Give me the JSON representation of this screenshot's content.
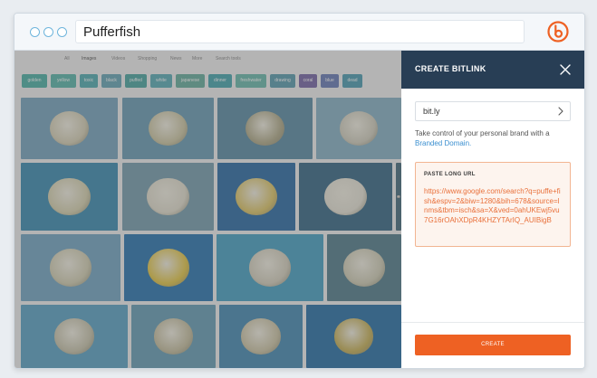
{
  "browser": {
    "url_text": "Pufferfish"
  },
  "search_page": {
    "tabs": [
      "All",
      "Images",
      "Videos",
      "Shopping",
      "News",
      "More",
      "Search tools"
    ],
    "chips": [
      {
        "label": "golden",
        "color": "#4fb3a8"
      },
      {
        "label": "yellow",
        "color": "#5cb8ad"
      },
      {
        "label": "toxic",
        "color": "#54aeb4"
      },
      {
        "label": "black",
        "color": "#6aa9b8"
      },
      {
        "label": "puffed",
        "color": "#4ea8a4"
      },
      {
        "label": "white",
        "color": "#5daeb9"
      },
      {
        "label": "japanese",
        "color": "#6ab0a0"
      },
      {
        "label": "dinner",
        "color": "#4aa8b0"
      },
      {
        "label": "freshwater",
        "color": "#6dbcae"
      },
      {
        "label": "drawing",
        "color": "#5d9fb1"
      },
      {
        "label": "coral",
        "color": "#7a6aa8"
      },
      {
        "label": "blue",
        "color": "#6b7fb8"
      },
      {
        "label": "dead",
        "color": "#4f9fb3"
      }
    ]
  },
  "panel": {
    "title": "CREATE BITLINK",
    "domain_value": "bit.ly",
    "info_text": "Take control of your personal brand with a",
    "info_link": "Branded Domain.",
    "paste_label": "PASTE LONG URL",
    "long_url": "https://www.google.com/search?q=puffe+fish&espv=2&biw=1280&bih=678&source=lnms&tbm=isch&sa=X&ved=0ahUKEwj5vu7G16rOAhXDpR4KHZYTArIQ_AUIBigB",
    "create_label": "CREATE"
  },
  "colors": {
    "brand_orange": "#ee6123",
    "panel_header": "#283e55",
    "link_blue": "#3a8fd0"
  },
  "icons": {
    "logo": "bitly-logo-icon",
    "close": "close-icon",
    "chevron": "chevron-right-icon"
  }
}
